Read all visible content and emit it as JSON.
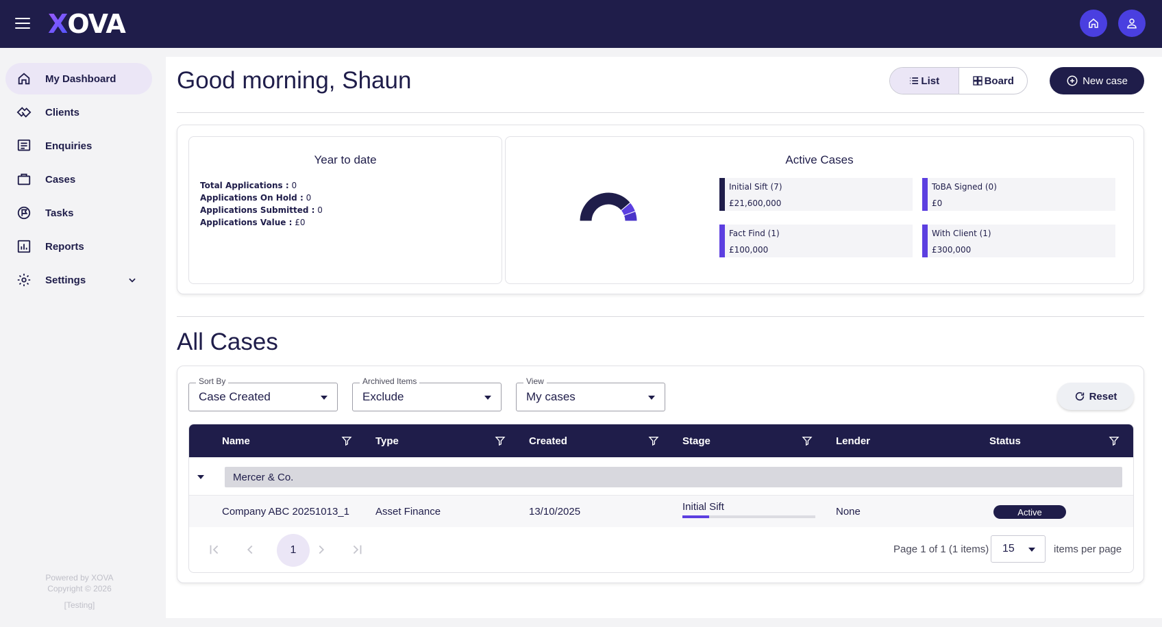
{
  "app": {
    "logo_x": "X",
    "logo_rest": "OVA"
  },
  "sidebar": {
    "items": [
      {
        "label": "My Dashboard",
        "icon": "home-icon",
        "active": true
      },
      {
        "label": "Clients",
        "icon": "handshake-icon"
      },
      {
        "label": "Enquiries",
        "icon": "list-box-icon"
      },
      {
        "label": "Cases",
        "icon": "briefcase-icon"
      },
      {
        "label": "Tasks",
        "icon": "flag-circle-icon"
      },
      {
        "label": "Reports",
        "icon": "bar-chart-icon"
      },
      {
        "label": "Settings",
        "icon": "gear-icon"
      }
    ],
    "footer": {
      "powered": "Powered by XOVA",
      "copyright": "Copyright © 2026",
      "env": "[Testing]"
    }
  },
  "header": {
    "greeting": "Good morning, Shaun",
    "view_list": "List",
    "view_board": "Board",
    "new_case": "New case"
  },
  "ytd": {
    "title": "Year to date",
    "lines": [
      {
        "label": "Total Applications :",
        "value": " 0"
      },
      {
        "label": "Applications On Hold :",
        "value": " 0"
      },
      {
        "label": "Applications Submitted :",
        "value": " 0"
      },
      {
        "label": "Applications Value :",
        "value": " £0"
      }
    ]
  },
  "active_cases": {
    "title": "Active Cases",
    "stages": [
      {
        "name": "Initial Sift (7)",
        "value": "£21,600,000",
        "color": "#1f1d4a"
      },
      {
        "name": "ToBA Signed (0)",
        "value": "£0",
        "color": "#5c3fe0"
      },
      {
        "name": "Fact Find (1)",
        "value": "£100,000",
        "color": "#5c3fe0"
      },
      {
        "name": "With Client (1)",
        "value": "£300,000",
        "color": "#5c3fe0"
      }
    ],
    "gauge_counts": [
      7,
      1,
      1
    ]
  },
  "all_cases": {
    "title": "All Cases",
    "filters": {
      "sort_by": {
        "legend": "Sort By",
        "value": "Case Created"
      },
      "archived": {
        "legend": "Archived Items",
        "value": "Exclude"
      },
      "view": {
        "legend": "View",
        "value": "My cases"
      }
    },
    "reset": "Reset",
    "columns": [
      "Name",
      "Type",
      "Created",
      "Stage",
      "Lender",
      "Status"
    ],
    "group": "Mercer & Co.",
    "rows": [
      {
        "name": "Company ABC 20251013_1",
        "type": "Asset Finance",
        "created": "13/10/2025",
        "stage": "Initial Sift",
        "stage_progress": 0.2,
        "lender": "None",
        "status": "Active"
      }
    ],
    "pager": {
      "current": "1",
      "info": "Page 1 of 1 (1 items)",
      "page_size": "15",
      "per_page": "items per page"
    }
  }
}
